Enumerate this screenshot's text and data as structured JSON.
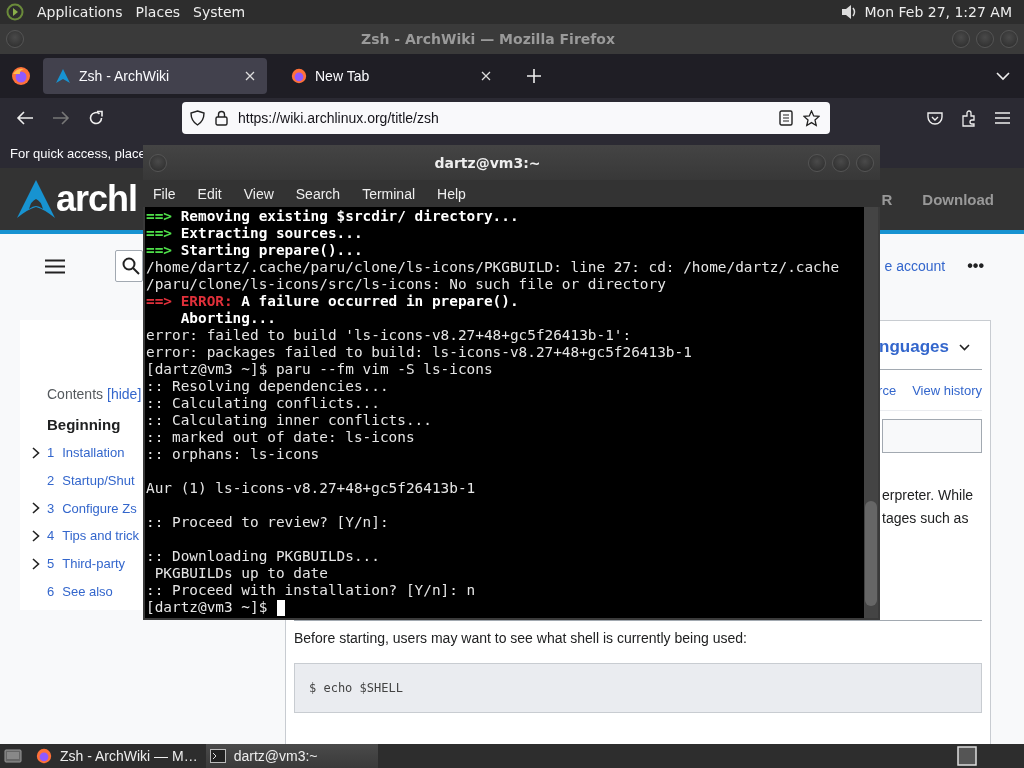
{
  "top_panel": {
    "menus": [
      "Applications",
      "Places",
      "System"
    ],
    "clock": "Mon Feb 27, 1:27 AM"
  },
  "browser": {
    "title": "Zsh - ArchWiki — Mozilla Firefox",
    "tabs": [
      {
        "label": "Zsh - ArchWiki",
        "selected": true,
        "kind": "wiki"
      },
      {
        "label": "New Tab",
        "selected": false,
        "kind": "firefox"
      }
    ],
    "forward_disabled": true,
    "url": "https://wiki.archlinux.org/title/zsh",
    "bookmarks_hint": "For quick access, place"
  },
  "wiki": {
    "logo": "archl",
    "nav": [
      "R",
      "Download"
    ],
    "account_link": "e account",
    "more": "•••",
    "contents": {
      "title": "Contents",
      "toggle": "[hide]",
      "heading": "Beginning",
      "items": [
        {
          "number": "1",
          "label": "Installation",
          "expandable": true
        },
        {
          "number": "2",
          "label": "Startup/Shut",
          "expandable": false
        },
        {
          "number": "3",
          "label": "Configure Zs",
          "expandable": true
        },
        {
          "number": "4",
          "label": "Tips and trick",
          "expandable": true
        },
        {
          "number": "5",
          "label": "Third-party",
          "expandable": true
        },
        {
          "number": "6",
          "label": "See also",
          "expandable": false
        }
      ]
    },
    "languages": "nguages",
    "page_tabs": [
      "rce",
      "View history"
    ],
    "intro_lines": [
      "erpreter. While",
      "tages such as"
    ],
    "paragraph": "Before starting, users may want to see what shell is currently being used:",
    "code": "$ echo $SHELL"
  },
  "terminal": {
    "title": "dartz@vm3:~",
    "menus": [
      "File",
      "Edit",
      "View",
      "Search",
      "Terminal",
      "Help"
    ],
    "lines": [
      {
        "kind": "step",
        "marker": "==>",
        "text": "Removing existing $srcdir/ directory..."
      },
      {
        "kind": "step",
        "marker": "==>",
        "text": "Extracting sources..."
      },
      {
        "kind": "step",
        "marker": "==>",
        "text": "Starting prepare()..."
      },
      {
        "kind": "plain",
        "text": "/home/dartz/.cache/paru/clone/ls-icons/PKGBUILD: line 27: cd: /home/dartz/.cache"
      },
      {
        "kind": "plain",
        "text": "/paru/clone/ls-icons/src/ls-icons: No such file or directory"
      },
      {
        "kind": "error",
        "marker": "==>",
        "label": "ERROR:",
        "text": "A failure occurred in prepare()."
      },
      {
        "kind": "indent",
        "text": "Aborting..."
      },
      {
        "kind": "plain",
        "text": "error: failed to build 'ls-icons-v8.27+48+gc5f26413b-1':"
      },
      {
        "kind": "plain",
        "text": "error: packages failed to build: ls-icons-v8.27+48+gc5f26413b-1"
      },
      {
        "kind": "plain",
        "text": "[dartz@vm3 ~]$ paru --fm vim -S ls-icons"
      },
      {
        "kind": "plain",
        "text": ":: Resolving dependencies..."
      },
      {
        "kind": "plain",
        "text": ":: Calculating conflicts..."
      },
      {
        "kind": "plain",
        "text": ":: Calculating inner conflicts..."
      },
      {
        "kind": "plain",
        "text": ":: marked out of date: ls-icons"
      },
      {
        "kind": "plain",
        "text": ":: orphans: ls-icons"
      },
      {
        "kind": "blank"
      },
      {
        "kind": "plain",
        "text": "Aur (1) ls-icons-v8.27+48+gc5f26413b-1"
      },
      {
        "kind": "blank"
      },
      {
        "kind": "plain",
        "text": ":: Proceed to review? [Y/n]:"
      },
      {
        "kind": "blank"
      },
      {
        "kind": "plain",
        "text": ":: Downloading PKGBUILDs..."
      },
      {
        "kind": "note",
        "text": "PKGBUILDs up to date"
      },
      {
        "kind": "plain",
        "text": ":: Proceed with installation? [Y/n]: n"
      },
      {
        "kind": "prompt",
        "text": "[dartz@vm3 ~]$",
        "cursor": true
      }
    ]
  },
  "taskbar": {
    "items": [
      {
        "label": "Zsh - ArchWiki — M…",
        "kind": "browser",
        "selected": false
      },
      {
        "label": "dartz@vm3:~",
        "kind": "terminal",
        "selected": true
      }
    ]
  }
}
